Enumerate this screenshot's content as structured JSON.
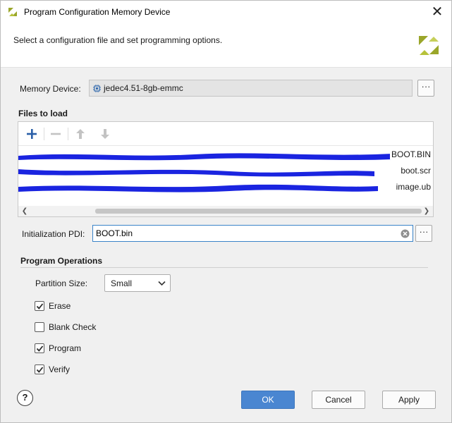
{
  "window": {
    "title": "Program Configuration Memory Device",
    "description": "Select a configuration file and set programming options."
  },
  "memory_device": {
    "label": "Memory Device:",
    "value": "jedec4.51-8gb-emmc"
  },
  "files": {
    "section_title": "Files to load",
    "rows": [
      {
        "file": "BOOT.BIN"
      },
      {
        "file": "boot.scr"
      },
      {
        "file": "image.ub"
      }
    ]
  },
  "pdi": {
    "label": "Initialization PDI:",
    "value": "BOOT.bin"
  },
  "operations": {
    "title": "Program Operations",
    "partition_label": "Partition Size:",
    "partition_value": "Small",
    "checkboxes": [
      {
        "label": "Erase",
        "checked": true
      },
      {
        "label": "Blank Check",
        "checked": false
      },
      {
        "label": "Program",
        "checked": true
      },
      {
        "label": "Verify",
        "checked": true
      }
    ]
  },
  "buttons": {
    "help": "?",
    "ok": "OK",
    "cancel": "Cancel",
    "apply": "Apply",
    "browse": "···"
  },
  "colors": {
    "accent": "#4a86d1",
    "redaction": "#1a24e0",
    "logo": "#9aa62a"
  },
  "icons": {
    "app": "app-logo-icon",
    "close": "close-icon",
    "add": "plus-icon",
    "remove": "minus-icon",
    "up": "arrow-up-icon",
    "down": "arrow-down-icon",
    "chip": "chip-icon",
    "clear": "clear-icon"
  }
}
